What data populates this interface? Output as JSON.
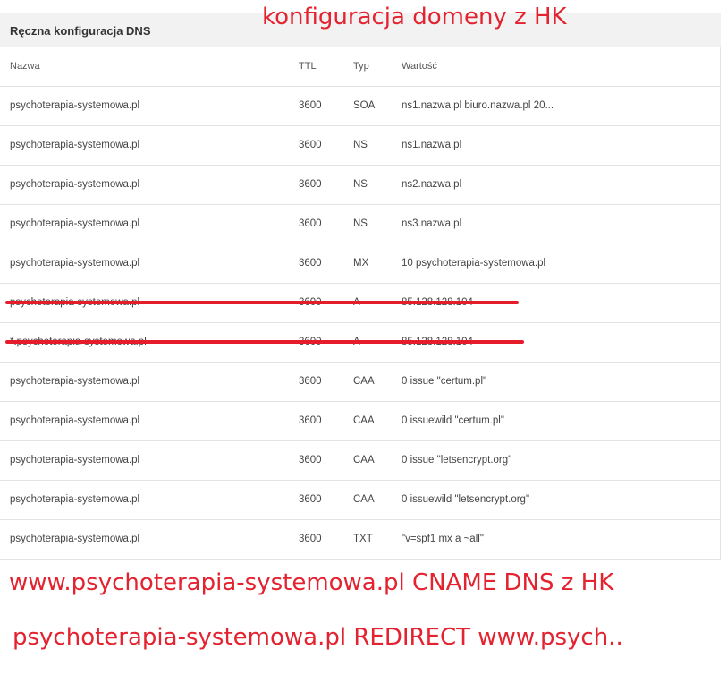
{
  "panel": {
    "title": "Ręczna konfiguracja DNS"
  },
  "annotations": {
    "top": "konfiguracja domeny z HK",
    "bottom_1": "www.psychoterapia-systemowa.pl CNAME DNS z HK",
    "bottom_2": "psychoterapia-systemowa.pl REDIRECT www.psych.."
  },
  "table": {
    "columns": [
      "Nazwa",
      "TTL",
      "Typ",
      "Wartość"
    ],
    "rows": [
      {
        "name": "psychoterapia-systemowa.pl",
        "ttl": "3600",
        "type": "SOA",
        "value": "ns1.nazwa.pl biuro.nazwa.pl 20..."
      },
      {
        "name": "psychoterapia-systemowa.pl",
        "ttl": "3600",
        "type": "NS",
        "value": "ns1.nazwa.pl"
      },
      {
        "name": "psychoterapia-systemowa.pl",
        "ttl": "3600",
        "type": "NS",
        "value": "ns2.nazwa.pl"
      },
      {
        "name": "psychoterapia-systemowa.pl",
        "ttl": "3600",
        "type": "NS",
        "value": "ns3.nazwa.pl"
      },
      {
        "name": "psychoterapia-systemowa.pl",
        "ttl": "3600",
        "type": "MX",
        "value": "10 psychoterapia-systemowa.pl"
      },
      {
        "name": "psychoterapia-systemowa.pl",
        "ttl": "3600",
        "type": "A",
        "value": "85.128.128.104",
        "struck": true
      },
      {
        "name": "*.psychoterapia-systemowa.pl",
        "ttl": "3600",
        "type": "A",
        "value": "85.128.128.104",
        "struck": true
      },
      {
        "name": "psychoterapia-systemowa.pl",
        "ttl": "3600",
        "type": "CAA",
        "value": "0 issue \"certum.pl\""
      },
      {
        "name": "psychoterapia-systemowa.pl",
        "ttl": "3600",
        "type": "CAA",
        "value": "0 issuewild \"certum.pl\""
      },
      {
        "name": "psychoterapia-systemowa.pl",
        "ttl": "3600",
        "type": "CAA",
        "value": "0 issue \"letsencrypt.org\""
      },
      {
        "name": "psychoterapia-systemowa.pl",
        "ttl": "3600",
        "type": "CAA",
        "value": "0 issuewild \"letsencrypt.org\""
      },
      {
        "name": "psychoterapia-systemowa.pl",
        "ttl": "3600",
        "type": "TXT",
        "value": "\"v=spf1 mx a ~all\""
      }
    ]
  },
  "colors": {
    "annotation": "#e32330",
    "strike": "#e51d2a",
    "header_bg": "#f2f2f2",
    "border": "#e3e3e3"
  }
}
